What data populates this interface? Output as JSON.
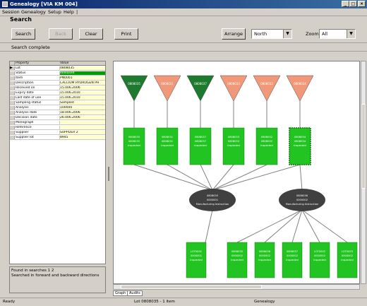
{
  "window": {
    "title": "Genealogy [VIA KM 004]"
  },
  "menu": [
    "Session",
    "Genealogy",
    "Setup",
    "Help",
    "|"
  ],
  "header": {
    "title": "Search"
  },
  "toolbar": {
    "search_label": "Search",
    "back_label": "Back",
    "clear_label": "Clear",
    "print_label": "Print",
    "arrange_label": "Arrange",
    "arrange_value": "North",
    "zoom_label": "Zoom",
    "zoom_value": "All"
  },
  "status_line": "Search complete",
  "properties": {
    "header": {
      "property": "Property",
      "value": "Value"
    },
    "rows": [
      {
        "property": "Lot",
        "value": "0808035"
      },
      {
        "property": "Status",
        "value": "Released"
      },
      {
        "property": "Item",
        "value": "PN0001"
      },
      {
        "property": "Description",
        "value": "CALCIUM HYDROGEN PH"
      },
      {
        "property": "Received on",
        "value": "15.006.2006"
      },
      {
        "property": "Expiry date",
        "value": "15.006.2010"
      },
      {
        "property": "Last date of use",
        "value": "15.006.2010"
      },
      {
        "property": "Sampling status",
        "value": "Sampled"
      },
      {
        "property": "Analysis",
        "value": "100000"
      },
      {
        "property": "Analysis date",
        "value": "18.006.2006"
      },
      {
        "property": "Decision date",
        "value": "26.006.2006"
      },
      {
        "property": "Monograph",
        "value": ""
      },
      {
        "property": "Reference",
        "value": ""
      },
      {
        "property": "Supplier",
        "value": "SUPPLIER 2"
      },
      {
        "property": "Supplier lot",
        "value": "8945"
      }
    ]
  },
  "info_panel": {
    "tabs": "Found in searches  1  2",
    "message": "Searched in forward and backward directions"
  },
  "graph": {
    "triangles": [
      {
        "label": "0808035",
        "color": "#1e7a2e"
      },
      {
        "label": "0808031",
        "color": "#f09878"
      },
      {
        "label": "0808037",
        "color": "#1e7a2e"
      },
      {
        "label": "0808033",
        "color": "#f09878"
      },
      {
        "label": "0808032",
        "color": "#f09878"
      },
      {
        "label": "0808034",
        "color": "#f09878"
      }
    ],
    "batches": [
      {
        "line1": "0808035",
        "line2": "0808035",
        "line3": "Inspected"
      },
      {
        "line1": "0808031",
        "line2": "0808031",
        "line3": "Inspected"
      },
      {
        "line1": "0808037",
        "line2": "0808037",
        "line3": "Inspected"
      },
      {
        "line1": "0808033",
        "line2": "0808033",
        "line3": "Inspected"
      },
      {
        "line1": "0808032",
        "line2": "0808032",
        "line3": "Inspected"
      },
      {
        "line1": "0808034",
        "line2": "0808034",
        "line3": "Inspected"
      }
    ],
    "processes": [
      {
        "line1": "0808035",
        "line2": "0000001",
        "line3": "Manufacturing Instruction"
      },
      {
        "line1": "0808036",
        "line2": "0000002",
        "line3": "Manufacturing Instruction"
      }
    ],
    "outputs": [
      {
        "line1": "LOT0001",
        "line2": "0000001",
        "line3": "Inspected"
      },
      {
        "line1": "0808035",
        "line2": "0000002",
        "line3": "Inspected"
      },
      {
        "line1": "0808036",
        "line2": "0000002",
        "line3": "Inspected"
      },
      {
        "line1": "0808037",
        "line2": "0000002",
        "line3": "Inspected"
      },
      {
        "line1": "LOT0002",
        "line2": "0000002",
        "line3": "Inspected"
      },
      {
        "line1": "LOT0003",
        "line2": "0000002",
        "line3": "Inspected"
      }
    ],
    "batch_color": "#22c422",
    "process_color": "#404040",
    "edge_color": "#808080"
  },
  "bottom_tabs": [
    "Graph",
    "Audits"
  ],
  "statusbar": {
    "left": "Ready",
    "middle": "Lot 0808035 - 1 item",
    "right": "Genealogy"
  }
}
